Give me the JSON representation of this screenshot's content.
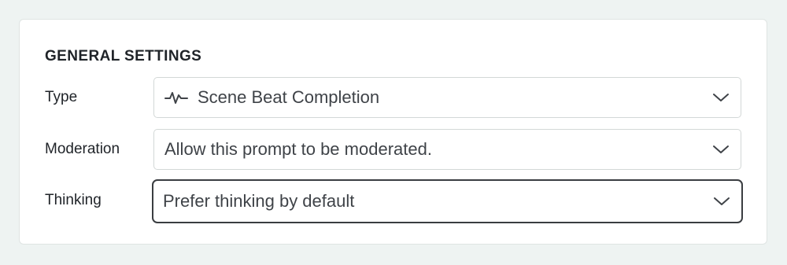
{
  "section": {
    "title": "GENERAL SETTINGS"
  },
  "fields": {
    "type": {
      "label": "Type",
      "value": "Scene Beat Completion",
      "icon": "activity-pulse-icon"
    },
    "moderation": {
      "label": "Moderation",
      "value": "Allow this prompt to be moderated."
    },
    "thinking": {
      "label": "Thinking",
      "value": "Prefer thinking by default"
    }
  },
  "colors": {
    "background": "#eef3f2",
    "card": "#ffffff",
    "text": "#1f2328",
    "focus_border": "#3a3d41"
  }
}
